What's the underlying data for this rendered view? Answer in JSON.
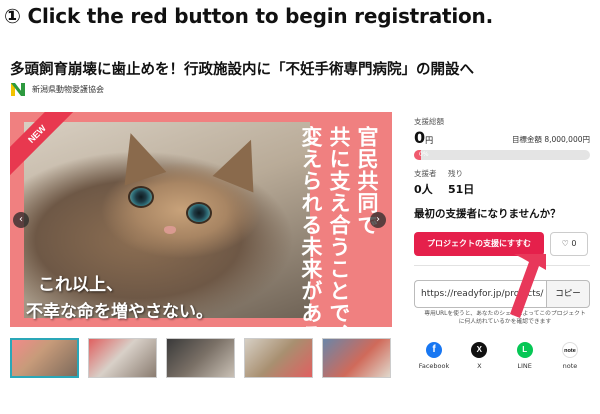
{
  "instruction": "① Click the red button to begin registration.",
  "project": {
    "title": "多頭飼育崩壊に歯止めを！行政施設内に「不妊手術専門病院」の開設へ",
    "organization": "新潟県動物愛護協会"
  },
  "hero": {
    "badge": "NEW",
    "vertical_lines": [
      "官民共同で",
      "共に支え合うことで、",
      "変えられる未来がある。"
    ],
    "caption_line1": "これ以上、",
    "caption_line2": "不幸な命を増やさない。",
    "prev_icon": "chevron-left-icon",
    "next_icon": "chevron-right-icon"
  },
  "thumbnails": [
    "thumb-1",
    "thumb-2",
    "thumb-3",
    "thumb-4",
    "thumb-5"
  ],
  "funding": {
    "total_label": "支援総額",
    "total_value": "0",
    "total_unit": "円",
    "goal_text": "目標金額 8,000,000円",
    "progress_text": "0%",
    "progress_fraction": 0,
    "supporters_label": "支援者",
    "supporters_value": "0人",
    "remaining_label": "残り",
    "remaining_value": "51日"
  },
  "cta": {
    "headline": "最初の支援者になりませんか？",
    "support_button": "プロジェクトの支援にすすむ",
    "favorite_count": "0",
    "favorite_icon": "heart-icon"
  },
  "share": {
    "url": "https://readyfor.jp/projects/",
    "copy_label": "コピー",
    "note": "専用URLを使うと、あなたのシェアによってこのプロジェクトに何人訪れているかを確認できます",
    "services": [
      {
        "name": "Facebook",
        "glyph": "f"
      },
      {
        "name": "X",
        "glyph": "X"
      },
      {
        "name": "LINE",
        "glyph": "L"
      },
      {
        "name": "note",
        "glyph": "note"
      }
    ]
  },
  "colors": {
    "accent": "#e5204b",
    "hero_bg": "#f08080",
    "arrow": "#e8385a",
    "facebook": "#1877f2",
    "x": "#111111",
    "line": "#06c755",
    "note": "#ffffff"
  }
}
